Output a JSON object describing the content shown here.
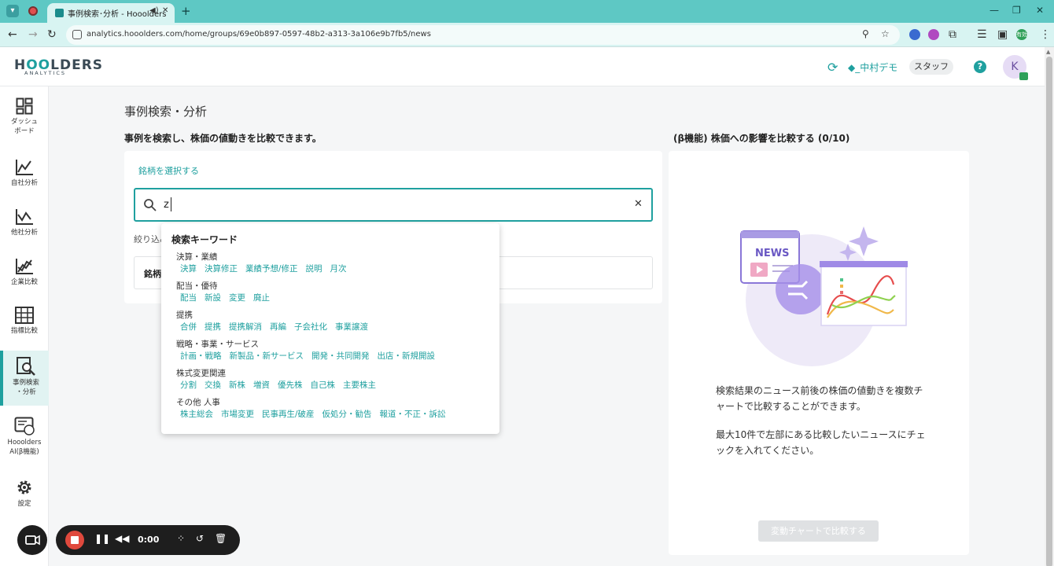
{
  "browser": {
    "tab_title": "事例検索･分析 - Hooolders",
    "url": "analytics.hooolders.com/home/groups/69e0b897-0597-48b2-a313-3a106e9b7fb5/news",
    "ext_label": "有効"
  },
  "header": {
    "logo_main": "HOOLDERS",
    "logo_sub": "ANALYTICS",
    "user_name": "◆_中村デモ",
    "role_badge": "スタッフ",
    "help": "?",
    "avatar_initial": "K"
  },
  "sidebar": {
    "items": [
      {
        "label": "ダッシュ\nボード"
      },
      {
        "label": "自社分析"
      },
      {
        "label": "他社分析"
      },
      {
        "label": "企業比較"
      },
      {
        "label": "指標比較"
      },
      {
        "label": "事例検索\n・分析"
      },
      {
        "label": "Hooolders\nAI(β機能)"
      },
      {
        "label": "設定"
      }
    ]
  },
  "main": {
    "page_title": "事例検索・分析",
    "left_heading": "事例を検索し、株価の値動きを比較できます。",
    "select_stock_link": "銘柄を選択する",
    "search_value": "z",
    "filter_label": "絞り込み",
    "stock_label": "銘柄"
  },
  "dropdown": {
    "heading": "検索キーワード",
    "groups": [
      {
        "category": "決算・業績",
        "keywords": [
          "決算",
          "決算修正",
          "業績予想/修正",
          "説明",
          "月次"
        ]
      },
      {
        "category": "配当・優待",
        "keywords": [
          "配当",
          "新設",
          "変更",
          "廃止"
        ]
      },
      {
        "category": "提携",
        "keywords": [
          "合併",
          "提携",
          "提携解消",
          "再編",
          "子会社化",
          "事業譲渡"
        ]
      },
      {
        "category": "戦略・事業・サービス",
        "keywords": [
          "計画・戦略",
          "新製品・新サービス",
          "開発・共同開発",
          "出店・新規開設"
        ]
      },
      {
        "category": "株式変更関連",
        "keywords": [
          "分割",
          "交換",
          "新株",
          "増資",
          "優先株",
          "自己株",
          "主要株主"
        ]
      },
      {
        "category": "その他 人事",
        "keywords": [
          "株主総会",
          "市場変更",
          "民事再生/破産",
          "仮処分・勧告",
          "報道・不正・訴訟"
        ]
      }
    ]
  },
  "right_panel": {
    "heading": "(β機能) 株価への影響を比較する (0/10)",
    "illustration_text": "NEWS",
    "desc1": "検索結果のニュース前後の株価の値動きを複数チャートで比較することができます。",
    "desc2": "最大10件で左部にある比較したいニュースにチェックを入れてください。",
    "compare_button": "変動チャートで比較する"
  },
  "recorder": {
    "time": "0:00"
  },
  "colors": {
    "accent": "#1fa09f",
    "chrome_tab": "#5ec8c4",
    "record_red": "#e0493d"
  }
}
